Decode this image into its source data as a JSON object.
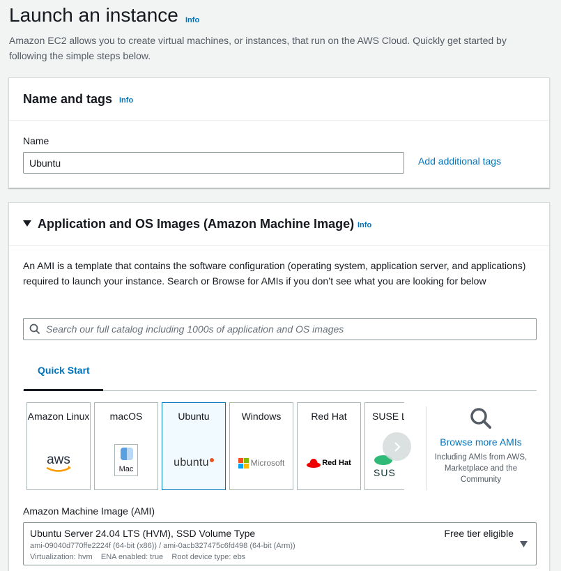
{
  "page": {
    "title": "Launch an instance",
    "info": "Info",
    "description": "Amazon EC2 allows you to create virtual machines, or instances, that run on the AWS Cloud. Quickly get started by following the simple steps below."
  },
  "name_tags": {
    "title": "Name and tags",
    "info": "Info",
    "name_label": "Name",
    "name_value": "Ubuntu",
    "add_tags": "Add additional tags"
  },
  "ami_section": {
    "title": "Application and OS Images (Amazon Machine Image)",
    "info": "Info",
    "description": "An AMI is a template that contains the software configuration (operating system, application server, and applications) required to launch your instance. Search or Browse for AMIs if you don’t see what you are looking for below",
    "search_placeholder": "Search our full catalog including 1000s of application and OS images",
    "tab_quick_start": "Quick Start",
    "tiles": [
      {
        "label": "Amazon Linux",
        "logo": "aws"
      },
      {
        "label": "macOS",
        "logo": "Mac"
      },
      {
        "label": "Ubuntu",
        "logo": "ubuntu",
        "selected": true
      },
      {
        "label": "Windows",
        "logo": "Microsoft"
      },
      {
        "label": "Red Hat",
        "logo": "Red Hat"
      },
      {
        "label": "SUSE Li",
        "logo": "SUS"
      }
    ],
    "browse_more": "Browse more AMIs",
    "browse_sub": "Including AMIs from AWS, Marketplace and the Community",
    "ami_label": "Amazon Machine Image (AMI)",
    "ami_name": "Ubuntu Server 24.04 LTS (HVM), SSD Volume Type",
    "ami_ids": "ami-09040d770ffe2224f (64-bit (x86)) / ami-0acb327475c6fd498 (64-bit (Arm))",
    "ami_meta": "Virtualization: hvm    ENA enabled: true    Root device type: ebs",
    "free_tier": "Free tier eligible"
  },
  "icons": {
    "search": "search-icon",
    "caret_down": "caret-down-icon",
    "chevron_right": "chevron-right-icon",
    "magnifier": "magnifier-icon"
  }
}
